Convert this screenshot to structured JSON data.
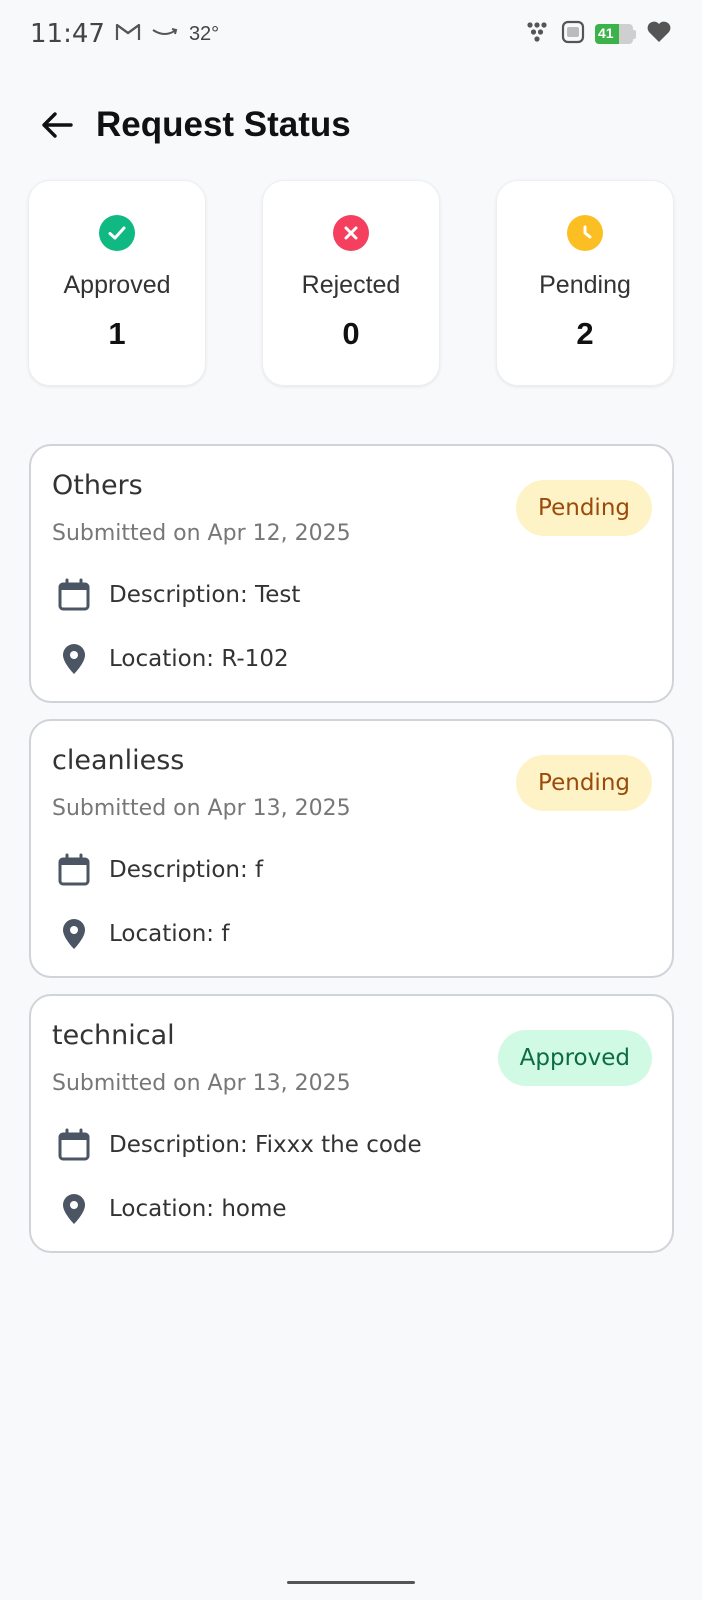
{
  "status_bar": {
    "time": "11:47",
    "temperature": "32°",
    "battery": "41"
  },
  "header": {
    "title": "Request Status"
  },
  "stats": [
    {
      "label": "Approved",
      "count": "1",
      "icon": "check-circle-icon",
      "color": "#10b981"
    },
    {
      "label": "Rejected",
      "count": "0",
      "icon": "x-circle-icon",
      "color": "#f43f5e"
    },
    {
      "label": "Pending",
      "count": "2",
      "icon": "clock-icon",
      "color": "#fbbf24"
    }
  ],
  "requests": [
    {
      "title": "Others",
      "submitted": "Submitted on Apr 12, 2025",
      "status": "Pending",
      "description": "Description: Test",
      "location": "Location: R-102"
    },
    {
      "title": "cleanliess",
      "submitted": "Submitted on Apr 13, 2025",
      "status": "Pending",
      "description": "Description: f",
      "location": "Location: f"
    },
    {
      "title": "technical",
      "submitted": "Submitted on Apr 13, 2025",
      "status": "Approved",
      "description": "Description: Fixxx the code",
      "location": "Location: home"
    }
  ]
}
